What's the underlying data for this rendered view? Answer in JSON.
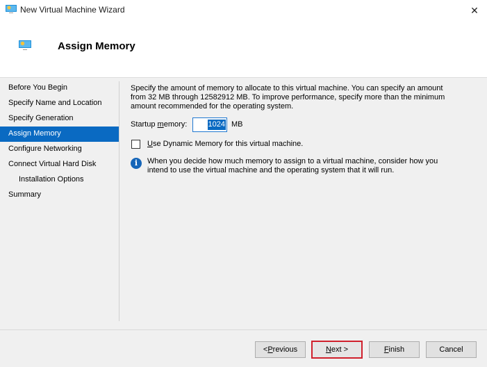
{
  "window": {
    "title": "New Virtual Machine Wizard",
    "close_icon": "close-icon"
  },
  "header": {
    "title": "Assign Memory",
    "icon": "virtual-machine-icon"
  },
  "nav": {
    "items": [
      {
        "label": "Before You Begin",
        "active": false,
        "indent": false
      },
      {
        "label": "Specify Name and Location",
        "active": false,
        "indent": false
      },
      {
        "label": "Specify Generation",
        "active": false,
        "indent": false
      },
      {
        "label": "Assign Memory",
        "active": true,
        "indent": false
      },
      {
        "label": "Configure Networking",
        "active": false,
        "indent": false
      },
      {
        "label": "Connect Virtual Hard Disk",
        "active": false,
        "indent": false
      },
      {
        "label": "Installation Options",
        "active": false,
        "indent": true
      },
      {
        "label": "Summary",
        "active": false,
        "indent": false
      }
    ]
  },
  "content": {
    "description": "Specify the amount of memory to allocate to this virtual machine. You can specify an amount from 32 MB through 12582912 MB. To improve performance, specify more than the minimum amount recommended for the operating system.",
    "startup_memory_label_pre": "Startup ",
    "startup_memory_label_u": "m",
    "startup_memory_label_post": "emory:",
    "startup_memory_value": "1024",
    "startup_memory_unit": "MB",
    "dynamic_memory_label_u": "U",
    "dynamic_memory_label_rest": "se Dynamic Memory for this virtual machine.",
    "dynamic_memory_checked": false,
    "info_text": "When you decide how much memory to assign to a virtual machine, consider how you intend to use the virtual machine and the operating system that it will run."
  },
  "buttons": {
    "previous_pre": "< ",
    "previous_u": "P",
    "previous_post": "revious",
    "next_u": "N",
    "next_post": "ext >",
    "finish_u": "F",
    "finish_post": "inish",
    "cancel": "Cancel"
  },
  "colors": {
    "selection": "#0a6ac2",
    "highlight_border": "#d0202c"
  }
}
